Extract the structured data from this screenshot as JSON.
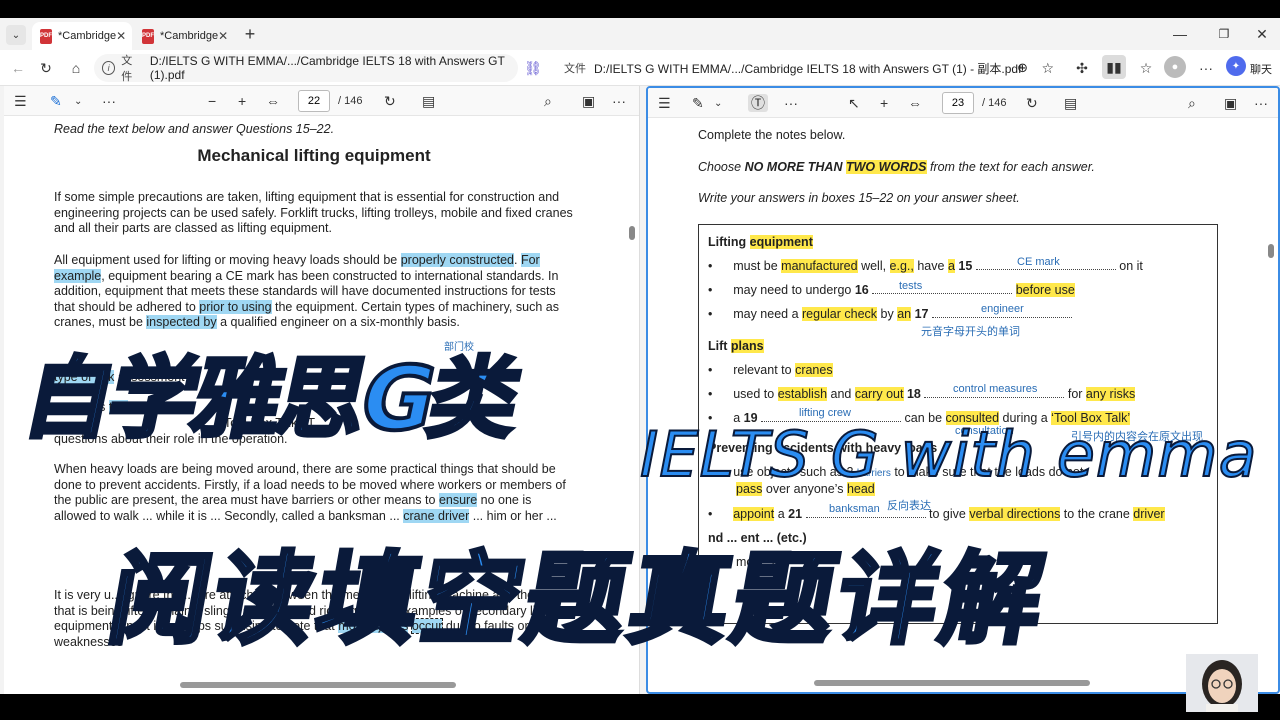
{
  "tabs": [
    {
      "label": "*Cambridge"
    },
    {
      "label": "*Cambridge"
    }
  ],
  "address": {
    "left": {
      "scheme": "文件",
      "url": "D:/IELTS G WITH EMMA/.../Cambridge IELTS 18 with Answers GT (1).pdf"
    },
    "right": {
      "scheme": "文件",
      "url": "D:/IELTS G WITH EMMA/.../Cambridge IELTS 18 with Answers GT (1) - 副本.pdf"
    },
    "chat_label": "聊天"
  },
  "left_pane": {
    "page": "22",
    "page_total": "/ 146"
  },
  "right_pane": {
    "page": "23",
    "page_total": "/ 146"
  },
  "left_doc": {
    "intro": "Read the text below and answer Questions 15–22.",
    "title": "Mechanical lifting equipment",
    "para1": "If some simple precautions are taken, lifting equipment that is essential for construction and engineering projects can be used safely. Forklift trucks, lifting trolleys, mobile and fixed cranes and all their parts are classed as lifting equipment.",
    "para2": {
      "a": "All equipment used for lifting or moving heavy loads should be ",
      "b": "properly constructed",
      "c": ". ",
      "d": "For example",
      "e": ", equipment bearing a CE mark has been constructed to international standards. In addition, equipment that meets these standards will have documented instructions for tests that should be adhered to ",
      "f": "prior to using",
      "g": " the equipment. Certain types of machinery, such as cranes, must be ",
      "h": "inspected by",
      "i": " a qualified engineer on a six-monthly basis."
    },
    "para3_frag": {
      "a": "type of risk",
      "b": "assessment",
      "c": "proceeds",
      "d": "talk",
      "e": "Tool Box Talk’ (T",
      "f": "questions about their role in the operation."
    },
    "para4": {
      "a": "When heavy loads are being moved around, there are some practical things that should be done to prevent accidents. Firstly, if a load needs to be moved where workers or members of the public are present, the area must have barriers or other means to ",
      "b": "ensure",
      "c": " no one is allowed to walk ... while it is ... Secondly, called a banksman ... ",
      "d": "crane driver",
      "e": " ... him or her ..."
    },
    "para5": {
      "a": "It is very u... ignore the ... are attached between the mechanical lifting machine and the load that is being lifted. Chains, slings, shackles and rigging are all examples of secondary lifting equipment, and it is perhaps surprising to note that ",
      "b": "most injuries",
      "c": " ",
      "d": "occur",
      "e": " due to faults or weaknesses"
    },
    "handwritten": "部门校"
  },
  "right_doc": {
    "instr1": "Complete the notes below.",
    "instr2": {
      "a": "Choose ",
      "b": "NO MORE THAN ",
      "c": "TWO WORDS",
      "d": " from the text for each answer."
    },
    "instr3": "Write your answers in boxes 15–22 on your answer sheet.",
    "sec1": {
      "a": "Lifting ",
      "b": "equipment"
    },
    "b1": {
      "a": "must be ",
      "b": "manufactured",
      "c": " well, ",
      "d": "e.g.,",
      "e": " have ",
      "f": "a",
      "g": "15",
      "h": "on it",
      "ans": "CE mark"
    },
    "b2": {
      "a": "may need to undergo ",
      "g": "16",
      "h": "before use",
      "ans": "tests"
    },
    "b3": {
      "a": "may need a ",
      "b": "regular check",
      "c": " by ",
      "d": "an",
      "g": "17",
      "ans": "engineer",
      "note": "元音字母开头的单词"
    },
    "sec2": {
      "a": "Lift ",
      "b": "plans"
    },
    "b4": {
      "a": "relevant to ",
      "b": "cranes"
    },
    "b5": {
      "a": "used to ",
      "b": "establish",
      "c": " and ",
      "d": "carry out",
      "g": "18",
      "h": "for ",
      "i": "any risks",
      "ans": "control measures"
    },
    "b6": {
      "a": "a ",
      "g": "19",
      "h": " can be ",
      "i": "consulted",
      "j": " during a ",
      "k": "‘Tool Box Talk’",
      "ans": "lifting crew",
      "ans2": "consultation",
      "note": "引号内的内容会在原文出现"
    },
    "sec3": "Preventing accidents with heavy loads",
    "b7": {
      "a": "use objects such as 2",
      "ans": "barriers",
      "h": "to make sure that the loads do not",
      "i": "pass",
      "j": " over anyone’s ",
      "k": "head",
      "note": "反向表达"
    },
    "b8": {
      "a": "appoint",
      "b": " a ",
      "g": "21",
      "h": " to give ",
      "i": "verbal directions",
      "j": " to the crane ",
      "k": "driver",
      "ans": "banksman"
    },
    "b9": {
      "a": "nd ... ent ... (etc.)",
      "b": "mo ... 22"
    }
  },
  "overlays": {
    "title1": "自学雅思G类",
    "title2": "IELTS G with emma",
    "title3": "阅读填空题真题详解"
  }
}
